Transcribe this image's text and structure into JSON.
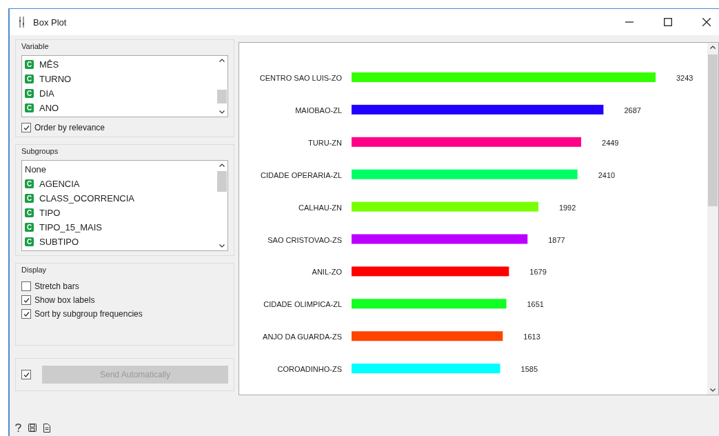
{
  "window": {
    "title": "Box Plot"
  },
  "variable": {
    "title": "Variable",
    "items": [
      {
        "badge": "C",
        "label": "MÊS",
        "selected": false
      },
      {
        "badge": "C",
        "label": "TURNO",
        "selected": false
      },
      {
        "badge": "C",
        "label": "DIA",
        "selected": false
      },
      {
        "badge": "C",
        "label": "ANO",
        "selected": false
      }
    ],
    "order_by_relevance": {
      "label": "Order by relevance",
      "checked": true
    }
  },
  "subgroups": {
    "title": "Subgroups",
    "items": [
      {
        "label": "None",
        "selected": false
      },
      {
        "badge": "C",
        "label": "AGENCIA",
        "selected": false
      },
      {
        "badge": "C",
        "label": "CLASS_OCORRENCIA",
        "selected": false
      },
      {
        "badge": "C",
        "label": "TIPO",
        "selected": false
      },
      {
        "badge": "C",
        "label": "TIPO_15_MAIS",
        "selected": false
      },
      {
        "badge": "C",
        "label": "SUBTIPO",
        "selected": false
      }
    ]
  },
  "display": {
    "title": "Display",
    "options": [
      {
        "label": "Stretch bars",
        "checked": false
      },
      {
        "label": "Show box labels",
        "checked": true
      },
      {
        "label": "Sort by subgroup frequencies",
        "checked": true
      }
    ]
  },
  "auto_send": {
    "checked": true,
    "button": "Send Automatically",
    "disabled": true
  },
  "plot": {
    "chart_data": {
      "type": "bar",
      "orientation": "horizontal",
      "data_labels": true,
      "categories": [
        "CENTRO SAO LUIS-ZO",
        "MAIOBAO-ZL",
        "TURU-ZN",
        "CIDADE OPERARIA-ZL",
        "CALHAU-ZN",
        "SAO CRISTOVAO-ZS",
        "ANIL-ZO",
        "CIDADE OLIMPICA-ZL",
        "ANJO DA GUARDA-ZS",
        "COROADINHO-ZS"
      ],
      "values": [
        3243,
        2687,
        2449,
        2410,
        1992,
        1877,
        1679,
        1651,
        1613,
        1585
      ],
      "colors": [
        "#33ff00",
        "#2200ff",
        "#ff0088",
        "#00ff66",
        "#77ff00",
        "#bb00ff",
        "#ff0000",
        "#11ff22",
        "#ff4400",
        "#00ffff"
      ]
    }
  }
}
